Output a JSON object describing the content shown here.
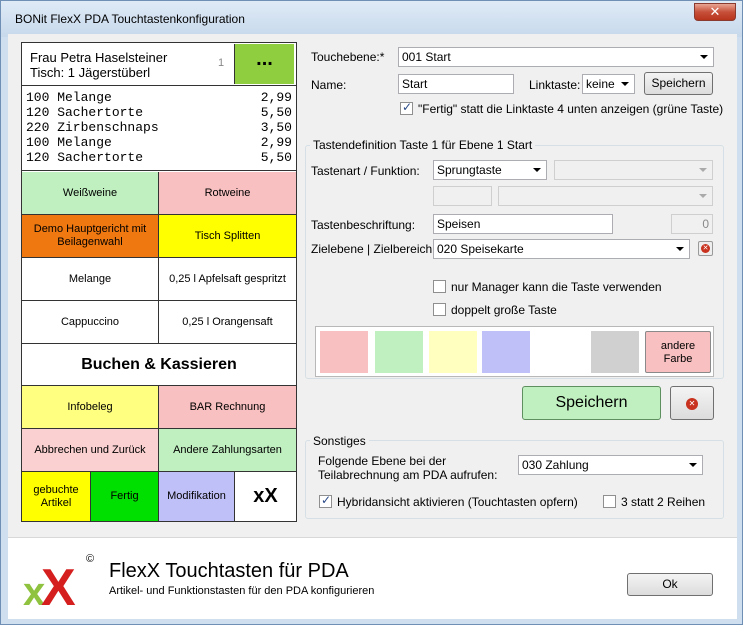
{
  "window": {
    "title": "BONit FlexX PDA Touchtastenkonfiguration",
    "close_glyph": "✕"
  },
  "pda": {
    "guest_name": "Frau Petra Haselsteiner",
    "table": "Tisch: 1 Jägerstüberl",
    "table_number": "1",
    "more_label": "...",
    "orders": [
      {
        "item": "100 Melange",
        "price": "2,99"
      },
      {
        "item": "120 Sachertorte",
        "price": "5,50"
      },
      {
        "item": "220 Zirbenschnaps",
        "price": "3,50"
      },
      {
        "item": "100 Melange",
        "price": "2,99"
      },
      {
        "item": "120 Sachertorte",
        "price": "5,50"
      }
    ],
    "buttons": {
      "weissweine": "Weißweine",
      "rotweine": "Rotweine",
      "demo_hauptgericht": "Demo Hauptgericht mit Beilagenwahl",
      "tisch_splitten": "Tisch Splitten",
      "melange": "Melange",
      "apfelsaft": "0,25 l Apfelsaft gespritzt",
      "cappuccino": "Cappuccino",
      "orangensaft": "0,25 l Orangensaft",
      "buchen_kassieren": "Buchen & Kassieren",
      "infobeleg": "Infobeleg",
      "bar_rechnung": "BAR Rechnung",
      "abbrechen": "Abbrechen und Zurück",
      "andere_zahlungsarten": "Andere Zahlungsarten",
      "gebuchte_artikel": "gebuchte Artikel",
      "fertig": "Fertig",
      "modifikation": "Modifikation",
      "xx": "xX"
    }
  },
  "form": {
    "touchebene_label": "Touchebene:*",
    "touchebene_value": "001 Start",
    "name_label": "Name:",
    "name_value": "Start",
    "linktaste_label": "Linktaste:",
    "linktaste_value": "keine",
    "save_label": "Speichern",
    "fertig_checkbox_label": "\"Fertig\" statt die Linktaste 4 unten anzeigen (grüne Taste)"
  },
  "tastendef": {
    "group_title": "Tastendefinition Taste 1 für Ebene 1 Start",
    "tastenart_label": "Tastenart / Funktion:",
    "tastenart_value": "Sprungtaste",
    "beschriftung_label": "Tastenbeschriftung:",
    "beschriftung_value": "Speisen",
    "count_value": "0",
    "zielebene_label": "Zielebene | Zielbereich:",
    "zielebene_value": "020 Speisekarte",
    "manager_label": "nur Manager kann die Taste verwenden",
    "doppelt_label": "doppelt große Taste",
    "colors": [
      "#f8c0c0",
      "#c0f0c0",
      "#ffffc0",
      "#c0c0f8",
      "#ffffff",
      "#d0d0d0"
    ],
    "andere_farbe_label": "andere Farbe",
    "andere_farbe_color": "#f8c0c0",
    "speichern_label": "Speichern",
    "speichern_color": "#c0f0c0"
  },
  "sonstiges": {
    "group_title": "Sonstiges",
    "folgende_label_1": "Folgende Ebene bei der",
    "folgende_label_2": "Teilabrechnung am PDA aufrufen:",
    "folgende_value": "030 Zahlung",
    "hybrid_label": "Hybridansicht aktivieren (Touchtasten opfern)",
    "reihen_label": "3 statt 2 Reihen"
  },
  "footer": {
    "title": "FlexX Touchtasten für PDA",
    "subtitle": "Artikel- und Funktionstasten für den PDA konfigurieren",
    "ok_label": "Ok",
    "logo_text": "xX",
    "logo_mark": "©"
  }
}
